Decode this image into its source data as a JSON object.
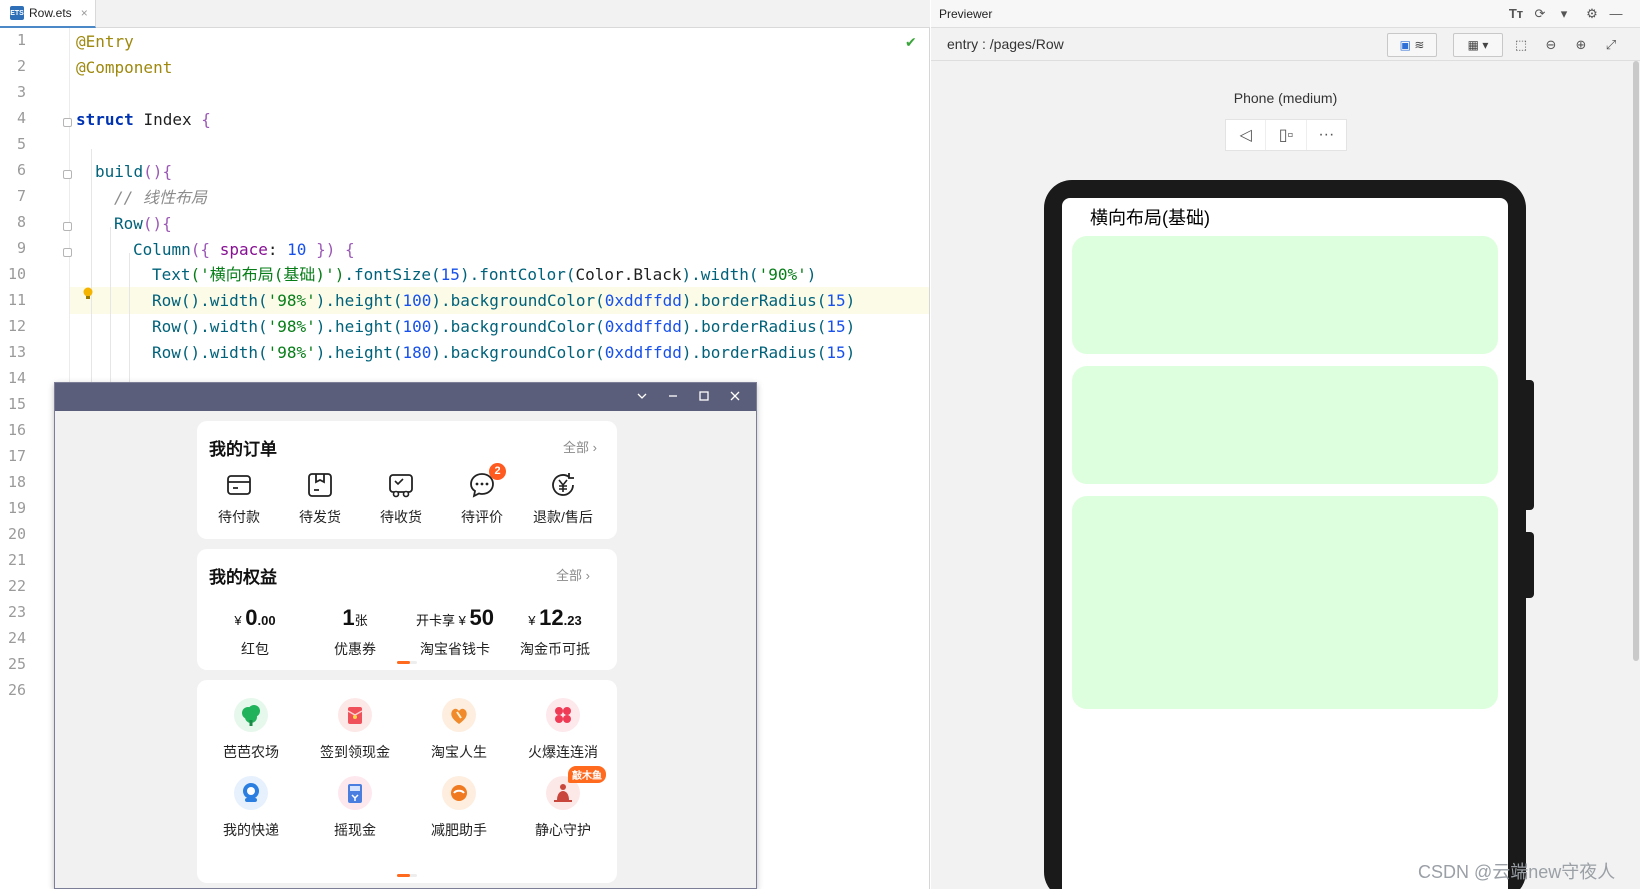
{
  "editor": {
    "tab_label": "Row.ets",
    "file_icon_text": "ETS",
    "line_numbers": [
      "1",
      "2",
      "3",
      "4",
      "5",
      "6",
      "7",
      "8",
      "9",
      "10",
      "11",
      "12",
      "13",
      "14",
      "15",
      "16",
      "17",
      "18",
      "19",
      "20",
      "21",
      "22",
      "23",
      "24",
      "25",
      "26"
    ],
    "code": {
      "l1": "@Entry",
      "l2": "@Component",
      "l4_kw": "struct",
      "l4_name": "Index",
      "l4_brace": "{",
      "l6_fn": "build",
      "l6_paren": "(){",
      "l7": "// 线性布局",
      "l8_fn": "Row",
      "l8_paren": "(){",
      "l9_fn": "Column",
      "l9_open": "({",
      "l9_prop": "space",
      "l9_colon": ":",
      "l9_num": "10",
      "l9_close": "}) {",
      "l10_a": "Text",
      "l10_b": "('横向布局(基础)')",
      "l10_c": ".fontSize(",
      "l10_d": "15",
      "l10_e": ").fontColor(",
      "l10_f": "Color.Black",
      "l10_g": ").width(",
      "l10_h": "'90%'",
      "l10_i": ")",
      "row_fn": "Row",
      "row_width": "().width(",
      "row_width_val": "'98%'",
      "row_height": ").height(",
      "row_height_100": "100",
      "row_height_180": "180",
      "row_bg": ").backgroundColor(",
      "row_bg_val": "0xddffdd",
      "row_radius": ").borderRadius(",
      "row_radius_val": "15",
      "row_end": ")"
    }
  },
  "floating_window": {
    "orders": {
      "title": "我的订单",
      "all": "全部",
      "items": [
        {
          "label": "待付款",
          "icon": "wallet-card-icon"
        },
        {
          "label": "待发货",
          "icon": "package-box-icon"
        },
        {
          "label": "待收货",
          "icon": "delivery-truck-icon"
        },
        {
          "label": "待评价",
          "icon": "chat-bubble-icon",
          "badge": "2"
        },
        {
          "label": "退款/售后",
          "icon": "yen-refund-icon"
        }
      ]
    },
    "benefits": {
      "title": "我的权益",
      "all": "全部",
      "items": [
        {
          "prefix": "¥",
          "value": "0",
          "suffix": ".00",
          "label": "红包"
        },
        {
          "prefix": "",
          "value": "1",
          "suffix": "张",
          "label": "优惠券"
        },
        {
          "prefix": "开卡享 ¥",
          "value": "50",
          "suffix": "",
          "label": "淘宝省钱卡"
        },
        {
          "prefix": "¥",
          "value": "12",
          "suffix": ".23",
          "label": "淘金币可抵"
        }
      ]
    },
    "services": {
      "items": [
        {
          "label": "芭芭农场",
          "icon": "tree-icon",
          "color": "#e6f7ec",
          "fg": "#21b35b"
        },
        {
          "label": "签到领现金",
          "icon": "red-envelope-icon",
          "color": "#fde8e8",
          "fg": "#f0505a"
        },
        {
          "label": "淘宝人生",
          "icon": "heart-icon",
          "color": "#fdeee0",
          "fg": "#f08a2a"
        },
        {
          "label": "火爆连连消",
          "icon": "clover-icon",
          "color": "#fde8ec",
          "fg": "#ef3b56"
        },
        {
          "label": "我的快递",
          "icon": "courier-icon",
          "color": "#e6f1fd",
          "fg": "#2b7fe0"
        },
        {
          "label": "摇现金",
          "icon": "cash-icon",
          "color": "#fde8ee",
          "fg": "#4a7fe0"
        },
        {
          "label": "减肥助手",
          "icon": "fitness-icon",
          "color": "#fdeee0",
          "fg": "#f07a20"
        },
        {
          "label": "静心守护",
          "icon": "meditation-icon",
          "color": "#fde8e8",
          "fg": "#c8463c",
          "tag": "敲木鱼"
        }
      ]
    }
  },
  "previewer": {
    "title": "Previewer",
    "path": "entry : /pages/Row",
    "device": "Phone (medium)",
    "screen_text": "横向布局(基础)"
  },
  "watermark": "CSDN @云端new守夜人",
  "colors": {
    "row_background": "#ddffdd",
    "accent_orange": "#ff6a1f",
    "window_title": "#5b5e7a"
  }
}
